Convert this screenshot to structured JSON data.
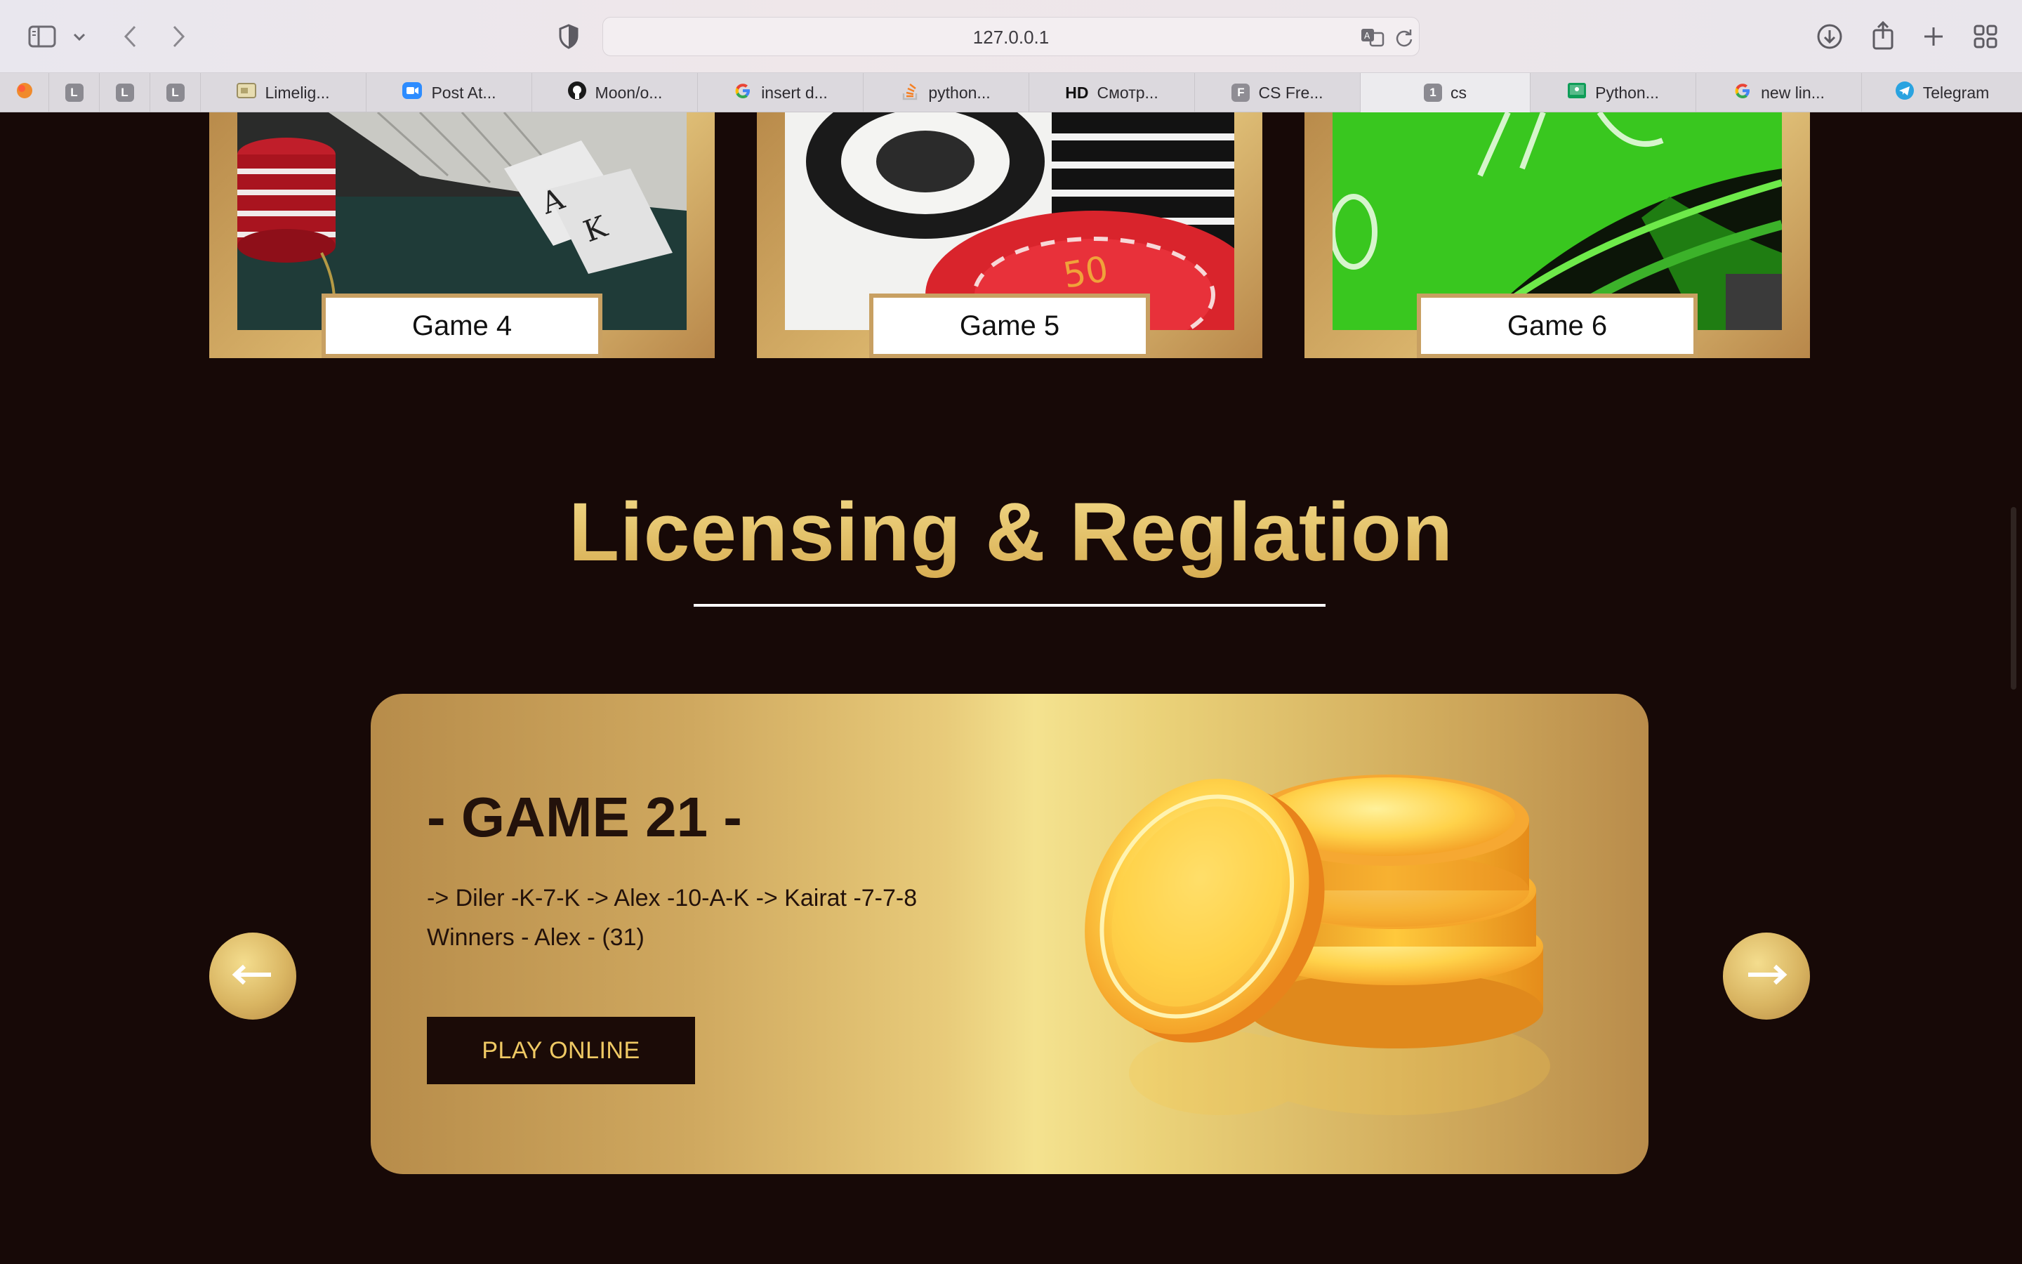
{
  "browser": {
    "url": "127.0.0.1",
    "tabs": [
      {
        "label": "",
        "icon": "firefox-like-icon"
      },
      {
        "label": "",
        "icon": "letter-l-icon",
        "letter": "L"
      },
      {
        "label": "",
        "icon": "letter-l-icon",
        "letter": "L"
      },
      {
        "label": "",
        "icon": "letter-l-icon",
        "letter": "L"
      },
      {
        "label": "Limelig...",
        "icon": "image-icon"
      },
      {
        "label": "Post At...",
        "icon": "video-icon"
      },
      {
        "label": "Moon/o...",
        "icon": "github-icon"
      },
      {
        "label": "insert d...",
        "icon": "google-icon"
      },
      {
        "label": "python...",
        "icon": "stackoverflow-icon"
      },
      {
        "label": "Смотр...",
        "icon": "hd-icon",
        "badge": "HD"
      },
      {
        "label": "CS Fre...",
        "icon": "letter-f-icon",
        "letter": "F"
      },
      {
        "label": "cs",
        "icon": "number-one-icon",
        "letter": "1",
        "active": true
      },
      {
        "label": "Python...",
        "icon": "classroom-icon"
      },
      {
        "label": "new lin...",
        "icon": "google-icon"
      },
      {
        "label": "Telegram",
        "icon": "telegram-icon"
      }
    ]
  },
  "games": [
    {
      "label": "Game 4"
    },
    {
      "label": "Game 5"
    },
    {
      "label": "Game 6"
    }
  ],
  "section": {
    "title": "Licensing & Reglation"
  },
  "slide": {
    "title": "- GAME 21 -",
    "line1": "-> Diler -K-7-K -> Alex -10-A-K -> Kairat -7-7-8",
    "line2": "Winners - Alex - (31)",
    "button": "PLAY ONLINE"
  },
  "colors": {
    "background": "#170907",
    "gold": "#e9c66c",
    "button_bg": "#1b0b07",
    "button_text": "#efc964"
  }
}
